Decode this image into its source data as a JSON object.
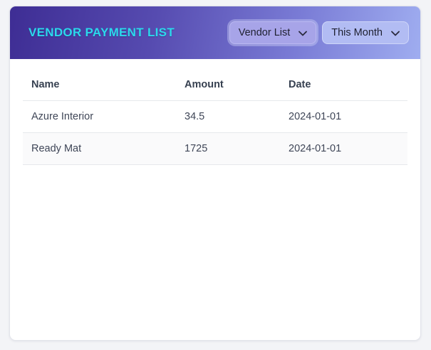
{
  "colors": {
    "page_background": "#f3f4f7",
    "header_gradient_start": "#3e2d94",
    "header_gradient_end": "#9fadf0",
    "title_accent": "#2bd9ec",
    "row_border": "#e6e8ec"
  },
  "header": {
    "title": "VENDOR PAYMENT LIST",
    "dropdowns": {
      "vendor": {
        "label": "Vendor List"
      },
      "period": {
        "label": "This Month"
      }
    },
    "chevron_icon": "chevron-down"
  },
  "table": {
    "columns": [
      "Name",
      "Amount",
      "Date"
    ],
    "rows": [
      [
        "Azure Interior",
        "34.5",
        "2024-01-01"
      ],
      [
        "Ready Mat",
        "1725",
        "2024-01-01"
      ]
    ]
  }
}
